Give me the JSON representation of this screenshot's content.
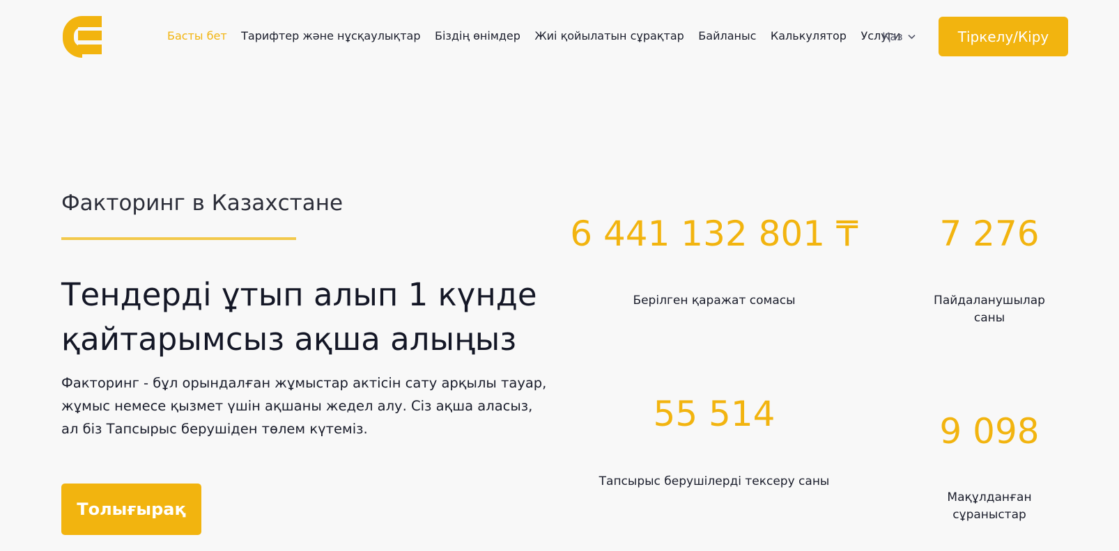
{
  "header": {
    "logo_icon": "brand-e-logo-icon",
    "nav": [
      {
        "label": "Басты бет",
        "active": true
      },
      {
        "label": "Тарифтер және нұсқаулықтар",
        "active": false
      },
      {
        "label": "Біздің өнімдер",
        "active": false
      },
      {
        "label": "Жиі қойылатын сұрақтар",
        "active": false
      },
      {
        "label": "Байланыс",
        "active": false
      },
      {
        "label": "Калькулятор",
        "active": false
      },
      {
        "label": "Услуги",
        "active": false
      }
    ],
    "language": "Қаз",
    "login_label": "Тіркелу/Кіру"
  },
  "hero": {
    "subtitle": "Факторинг в Казахстане",
    "headline": "Тендерді ұтып алып 1 күнде қайтарымсыз ақша алыңыз",
    "description": "Факторинг - бұл орындалған жұмыстар актісін сату арқылы тауар, жұмыс немесе қызмет үшін ақшаны жедел алу. Сіз ақша аласыз, ал біз Тапсырыс берушіден төлем күтеміз.",
    "more_label": "Толығырақ"
  },
  "stats": [
    {
      "value": "6 441 132 801 ₸",
      "label": "Берілген қаражат сомасы"
    },
    {
      "value": "7 276",
      "label": "Пайдаланушылар саны"
    },
    {
      "value": "55 514",
      "label": "Тапсырыс берушілерді тексеру саны"
    },
    {
      "value": "9 098",
      "label": "Мақұлданған сұраныстар"
    }
  ],
  "colors": {
    "accent": "#f2b40f",
    "background": "#f8f8f8",
    "text": "#1a1d2b"
  }
}
